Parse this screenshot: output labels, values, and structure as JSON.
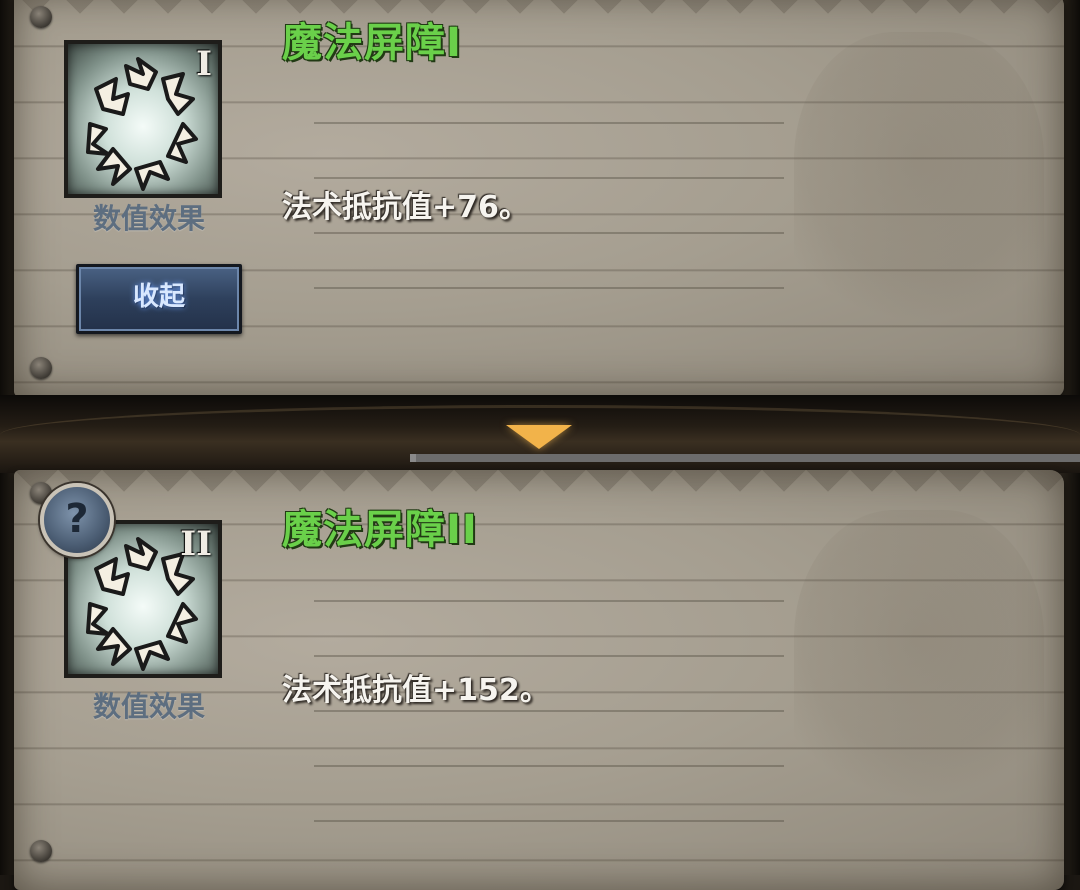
{
  "skills": [
    {
      "tier": "I",
      "title": "魔法屏障I",
      "category": "数值效果",
      "description": "法术抵抗值+76。"
    },
    {
      "tier": "II",
      "title": "魔法屏障II",
      "category": "数值效果",
      "description": "法术抵抗值+152。"
    }
  ],
  "collapse_button": {
    "label": "收起"
  },
  "help_badge": {
    "label": "?"
  },
  "colors": {
    "title_green": "#6ad04a",
    "category_blue": "#5d6e80",
    "button_blue": "#2e405c",
    "arrow_gold": "#f2b34a"
  },
  "icons": {
    "skill_icon": "magic-barrier-shatter-icon",
    "expand_arrow": "triangle-down-icon",
    "help": "question-mark-icon"
  }
}
